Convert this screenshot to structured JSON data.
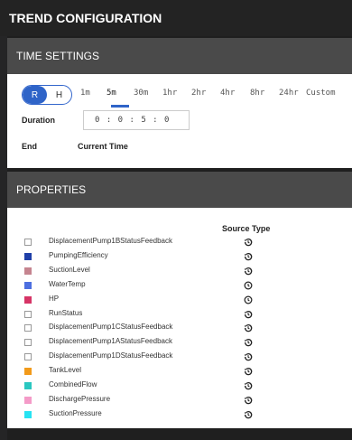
{
  "title": "TREND CONFIGURATION",
  "time_settings": {
    "header": "TIME SETTINGS",
    "toggle": {
      "left": "R",
      "right": "H"
    },
    "ranges": [
      "1m",
      "5m",
      "30m",
      "1hr",
      "2hr",
      "4hr",
      "8hr",
      "24hr",
      "Custom"
    ],
    "selected_range": "5m",
    "duration_label": "Duration",
    "duration_value": "0 : 0 : 5 : 0",
    "end_label": "End",
    "end_value": "Current Time"
  },
  "properties": {
    "header": "PROPERTIES",
    "source_type_header": "Source Type",
    "items": [
      {
        "name": "DisplacementPump1BStatusFeedback",
        "color": null,
        "icon": "history-icon"
      },
      {
        "name": "PumpingEfficiency",
        "color": "#1f3fa8",
        "icon": "history-icon"
      },
      {
        "name": "SuctionLevel",
        "color": "#c5848f",
        "icon": "history-icon"
      },
      {
        "name": "WaterTemp",
        "color": "#4d6fe0",
        "icon": "clock-icon"
      },
      {
        "name": "HP",
        "color": "#d63466",
        "icon": "clock-icon"
      },
      {
        "name": "RunStatus",
        "color": null,
        "icon": "history-icon"
      },
      {
        "name": "DisplacementPump1CStatusFeedback",
        "color": null,
        "icon": "history-icon"
      },
      {
        "name": "DisplacementPump1AStatusFeedback",
        "color": null,
        "icon": "history-icon"
      },
      {
        "name": "DisplacementPump1DStatusFeedback",
        "color": null,
        "icon": "history-icon"
      },
      {
        "name": "TankLevel",
        "color": "#f29a1a",
        "icon": "history-icon"
      },
      {
        "name": "CombinedFlow",
        "color": "#2ac7c0",
        "icon": "history-icon"
      },
      {
        "name": "DischargePressure",
        "color": "#f49bc8",
        "icon": "history-icon"
      },
      {
        "name": "SuctionPressure",
        "color": "#27e3f2",
        "icon": "history-icon"
      }
    ]
  }
}
